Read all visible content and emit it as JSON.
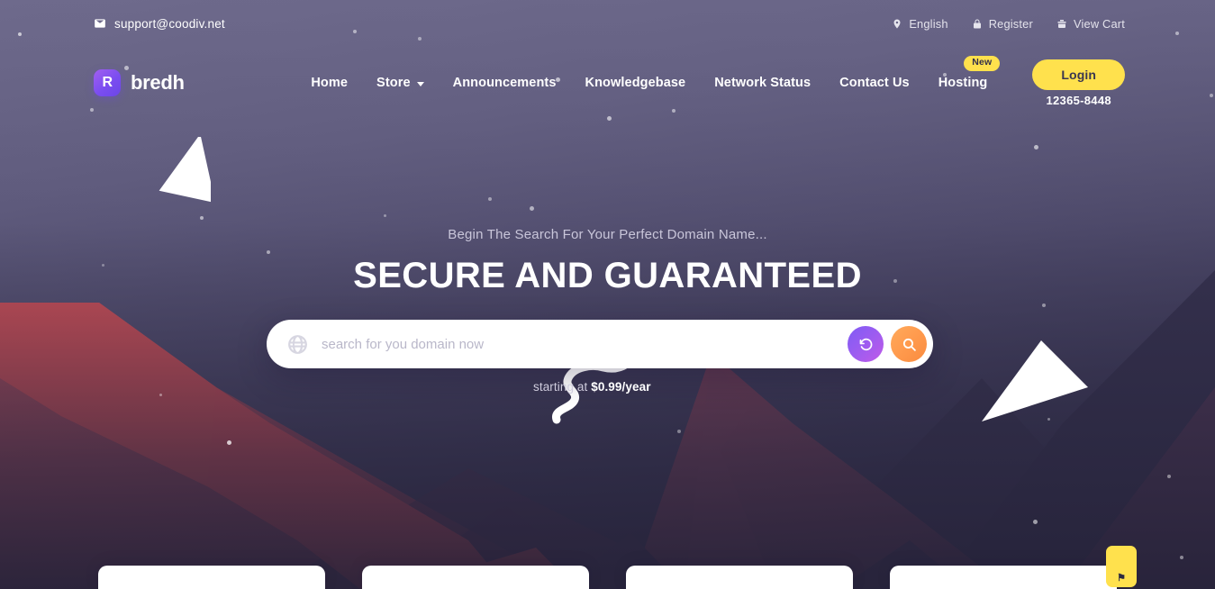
{
  "topbar": {
    "email": "support@coodiv.net",
    "email_icon": "mail-icon",
    "right_items": [
      {
        "label": "English",
        "icon": "location-pin-icon"
      },
      {
        "label": "Register",
        "icon": "lock-icon"
      },
      {
        "label": "View Cart",
        "icon": "shopping-bag-icon"
      }
    ]
  },
  "brand": {
    "mark_letter": "R",
    "name": "bredh"
  },
  "nav": {
    "links": [
      {
        "label": "Home",
        "has_caret": false,
        "badge": null
      },
      {
        "label": "Store",
        "has_caret": true,
        "badge": null
      },
      {
        "label": "Announcements",
        "has_caret": false,
        "badge": null
      },
      {
        "label": "Knowledgebase",
        "has_caret": false,
        "badge": null
      },
      {
        "label": "Network Status",
        "has_caret": false,
        "badge": null
      },
      {
        "label": "Contact Us",
        "has_caret": false,
        "badge": null
      },
      {
        "label": "Hosting",
        "has_caret": false,
        "badge": "New"
      }
    ],
    "login_label": "Login",
    "phone": "12365-8448"
  },
  "hero": {
    "kicker": "Begin The Search For Your Perfect Domain Name...",
    "title": "SECURE AND GUARANTEED"
  },
  "search": {
    "placeholder": "search for you domain now",
    "value": "",
    "globe_icon": "globe-icon",
    "reset_icon": "reset-arrow-icon",
    "search_icon": "magnifier-icon",
    "price_prefix": "starting at ",
    "price_value": "$0.99/year"
  },
  "cards": {
    "count": 4,
    "badge_glyph": "⚑"
  },
  "colors": {
    "accent_yellow": "#ffe14d",
    "accent_purple": "#7f5bf5",
    "accent_orange": "#ff9a4d",
    "sky_top": "#6a6685",
    "sky_bottom": "#353250",
    "mountain_red": "#f8504f",
    "mountain_dark": "#3b2e48",
    "card_white": "#ffffff"
  }
}
